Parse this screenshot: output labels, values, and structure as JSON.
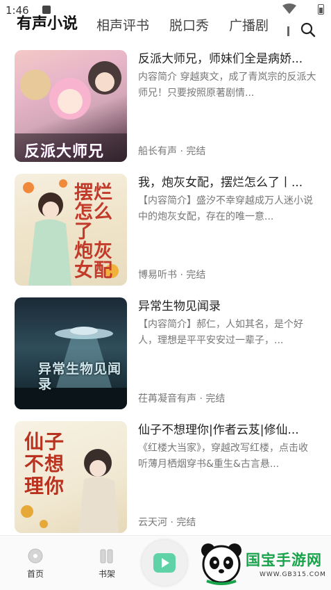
{
  "status_bar": {
    "time": "1:46"
  },
  "tabs": [
    {
      "label": "有声小说",
      "active": true
    },
    {
      "label": "相声评书",
      "active": false
    },
    {
      "label": "脱口秀",
      "active": false
    },
    {
      "label": "广播剧",
      "active": false
    }
  ],
  "items": [
    {
      "title": "反派大师兄，师妹们全是病娇...",
      "desc": "内容简介 穿越爽文，成了青岚宗的反派大师兄！只要按照原著剧情...",
      "meta": "船长有声 · 完结",
      "cover_text": "反派大师兄"
    },
    {
      "title": "我，炮灰女配，摆烂怎么了丨...",
      "desc": "【内容简介】盛汐不幸穿越成万人迷小说中的炮灰女配，存在的唯一意...",
      "meta": "博易听书 · 完结",
      "cover_text": "摆烂怎么了 炮灰女配"
    },
    {
      "title": "异常生物见闻录",
      "desc": "【内容简介】郝仁，人如其名，是个好人，理想是平平安安过一辈子，...",
      "meta": "茌苒凝音有声 · 完结",
      "cover_text": "异常生物见闻录"
    },
    {
      "title": "仙子不想理你|作者云芨|修仙...",
      "desc": "《红楼大当家》，穿越改写红楼，点击收听薄月栖烟穿书&重生&古言悬...",
      "meta": "云天河 · 完结",
      "cover_text": "仙子不想理你"
    }
  ],
  "bottom_nav": {
    "home_label": "首页",
    "shelf_label": "书架"
  },
  "watermark": {
    "name": "国宝手游网",
    "url": "WWW.GB315.COM"
  },
  "colors": {
    "accent": "#5fd2a8",
    "watermark_green": "#17a34a"
  }
}
